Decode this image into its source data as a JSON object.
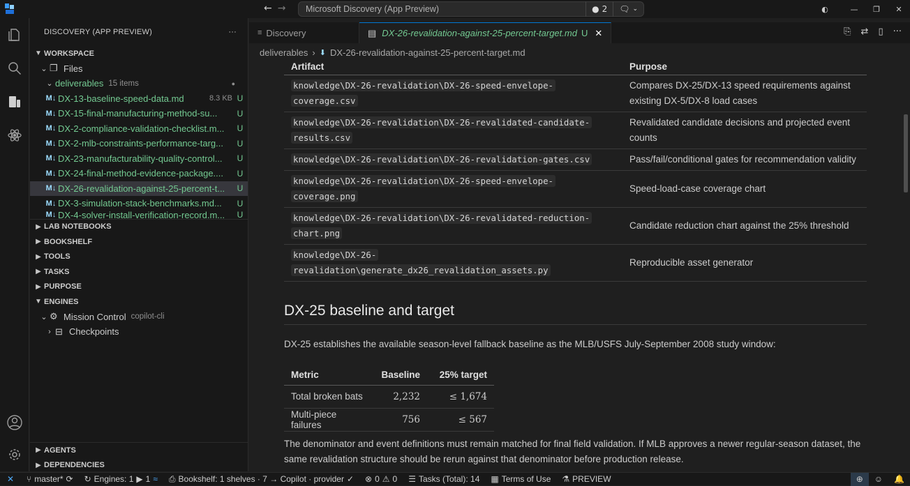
{
  "titlebar": {
    "command_center": "Microsoft Discovery (App Preview)",
    "count_badge": "2"
  },
  "sidebar": {
    "header": "DISCOVERY (APP PREVIEW)",
    "workspace": "WORKSPACE",
    "files_label": "Files",
    "folder": {
      "name": "deliverables",
      "desc": "15 items"
    },
    "files": [
      {
        "name": "DX-13-baseline-speed-data.md",
        "size": "8.3 KB",
        "status": "U"
      },
      {
        "name": "DX-15-final-manufacturing-method-su...",
        "size": "",
        "status": "U"
      },
      {
        "name": "DX-2-compliance-validation-checklist.m...",
        "size": "",
        "status": "U"
      },
      {
        "name": "DX-2-mlb-constraints-performance-targ...",
        "size": "",
        "status": "U"
      },
      {
        "name": "DX-23-manufacturability-quality-control...",
        "size": "",
        "status": "U"
      },
      {
        "name": "DX-24-final-method-evidence-package....",
        "size": "",
        "status": "U"
      },
      {
        "name": "DX-26-revalidation-against-25-percent-t...",
        "size": "",
        "status": "U"
      },
      {
        "name": "DX-3-simulation-stack-benchmarks.md...",
        "size": "",
        "status": "U"
      },
      {
        "name": "DX-4-solver-install-verification-record.m...",
        "size": "",
        "status": "U"
      }
    ],
    "sections": [
      "LAB NOTEBOOKS",
      "BOOKSHELF",
      "TOOLS",
      "TASKS",
      "PURPOSE"
    ],
    "engines": "ENGINES",
    "mission_control": {
      "name": "Mission Control",
      "desc": "copilot-cli"
    },
    "checkpoints": "Checkpoints",
    "bottom_sections": [
      "AGENTS",
      "DEPENDENCIES"
    ]
  },
  "tabs": [
    {
      "label": "Discovery"
    },
    {
      "label": "DX-26-revalidation-against-25-percent-target.md",
      "status": "U"
    }
  ],
  "breadcrumb": {
    "folder": "deliverables",
    "file": "DX-26-revalidation-against-25-percent-target.md"
  },
  "doc": {
    "artifact_table": {
      "headers": [
        "Artifact",
        "Purpose"
      ],
      "rows": [
        {
          "artifact_l1": "knowledge\\DX-26-revalidation\\DX-26-speed-envelope-",
          "artifact_l2": "coverage.csv",
          "purpose": "Compares DX-25/DX-13 speed requirements against existing DX-5/DX-8 load cases"
        },
        {
          "artifact_l1": "knowledge\\DX-26-revalidation\\DX-26-revalidated-candidate-",
          "artifact_l2": "results.csv",
          "purpose": "Revalidated candidate decisions and projected event counts"
        },
        {
          "artifact_l1": "knowledge\\DX-26-revalidation\\DX-26-revalidation-gates.csv",
          "artifact_l2": "",
          "purpose": "Pass/fail/conditional gates for recommendation validity"
        },
        {
          "artifact_l1": "knowledge\\DX-26-revalidation\\DX-26-speed-envelope-",
          "artifact_l2": "coverage.png",
          "purpose": "Speed-load-case coverage chart"
        },
        {
          "artifact_l1": "knowledge\\DX-26-revalidation\\DX-26-revalidated-reduction-",
          "artifact_l2": "chart.png",
          "purpose": "Candidate reduction chart against the 25% threshold"
        },
        {
          "artifact_l1": "knowledge\\DX-26-",
          "artifact_l2": "revalidation\\generate_dx26_revalidation_assets.py",
          "purpose": "Reproducible asset generator"
        }
      ]
    },
    "heading": "DX-25 baseline and target",
    "intro": "DX-25 establishes the available season-level fallback baseline as the MLB/USFS July-September 2008 study window:",
    "metric_table": {
      "headers": [
        "Metric",
        "Baseline",
        "25% target"
      ],
      "rows": [
        {
          "metric": "Total broken bats",
          "baseline": "2,232",
          "target": "≤ 1,674"
        },
        {
          "metric": "Multi-piece failures",
          "baseline": "756",
          "target": "≤ 567"
        }
      ]
    },
    "closing": "The denominator and event definitions must remain matched for final field validation. If MLB approves a newer regular-season dataset, the same revalidation structure should be rerun against that denominator before production release."
  },
  "statusbar": {
    "branch": "master*",
    "engines": "Engines: 1",
    "running": "1",
    "bookshelf": "Bookshelf: 1 shelves · 7 → Copilot · provider",
    "errors": "0",
    "warnings": "0",
    "tasks": "Tasks (Total): 14",
    "terms": "Terms of Use",
    "preview": "PREVIEW"
  },
  "colors": {
    "accent": "#0078d4",
    "untracked": "#73c991",
    "background": "#1f1f1f",
    "sidebar": "#181818"
  }
}
